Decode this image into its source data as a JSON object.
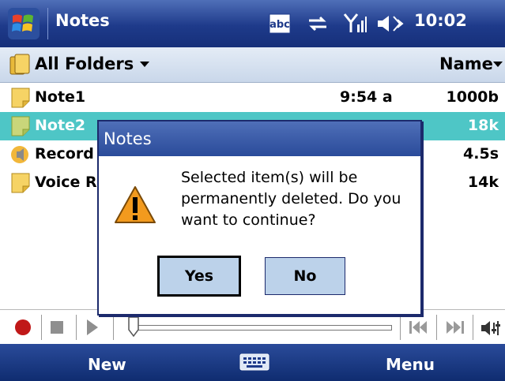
{
  "titlebar": {
    "app_title": "Notes",
    "clock": "10:02",
    "input_mode": "abc"
  },
  "folderbar": {
    "folder": "All Folders",
    "sort": "Name"
  },
  "notes": [
    {
      "name": "Note1",
      "time": "9:54 a",
      "size": "1000b"
    },
    {
      "name": "Note2",
      "time": "",
      "size": "18k"
    },
    {
      "name": "Record",
      "time": "",
      "size": "4.5s"
    },
    {
      "name": "Voice R",
      "time": "",
      "size": "14k"
    }
  ],
  "softkeys": {
    "left": "New",
    "right": "Menu"
  },
  "dialog": {
    "title": "Notes",
    "message": "Selected item(s) will be permanently deleted. Do you want to continue?",
    "yes": "Yes",
    "no": "No"
  },
  "colors": {
    "titlebar": "#1e3a8a",
    "selection": "#4ec6c6",
    "button": "#bcd2ea"
  }
}
